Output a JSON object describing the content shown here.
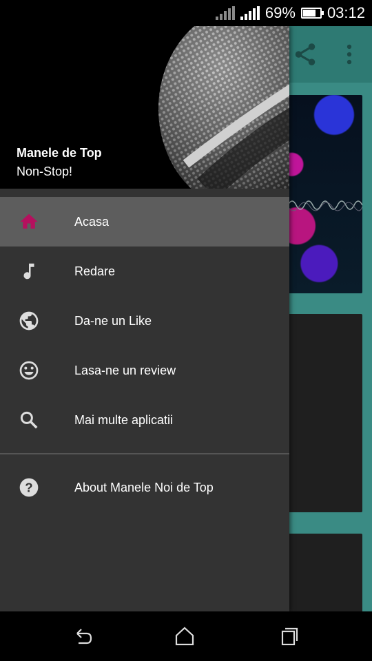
{
  "status_bar": {
    "battery": "69%",
    "time": "03:12",
    "battery_level": 0.69
  },
  "drawer": {
    "header": {
      "title": "Manele de Top",
      "subtitle": "Non-Stop!"
    },
    "items": [
      {
        "label": "Acasa",
        "icon": "home-icon",
        "active": true
      },
      {
        "label": "Redare",
        "icon": "music-note-icon",
        "active": false
      },
      {
        "label": "Da-ne un Like",
        "icon": "globe-icon",
        "active": false
      },
      {
        "label": "Lasa-ne un review",
        "icon": "smiley-icon",
        "active": false
      },
      {
        "label": "Mai multe aplicatii",
        "icon": "search-icon",
        "active": false
      }
    ],
    "secondary_items": [
      {
        "label": "About Manele Noi de Top",
        "icon": "help-icon",
        "active": false
      }
    ]
  },
  "colors": {
    "accent": "#b5105e",
    "drawer_bg": "#333333",
    "active_item_bg": "#5d5d5d",
    "app_bg": "#3a8b84"
  }
}
